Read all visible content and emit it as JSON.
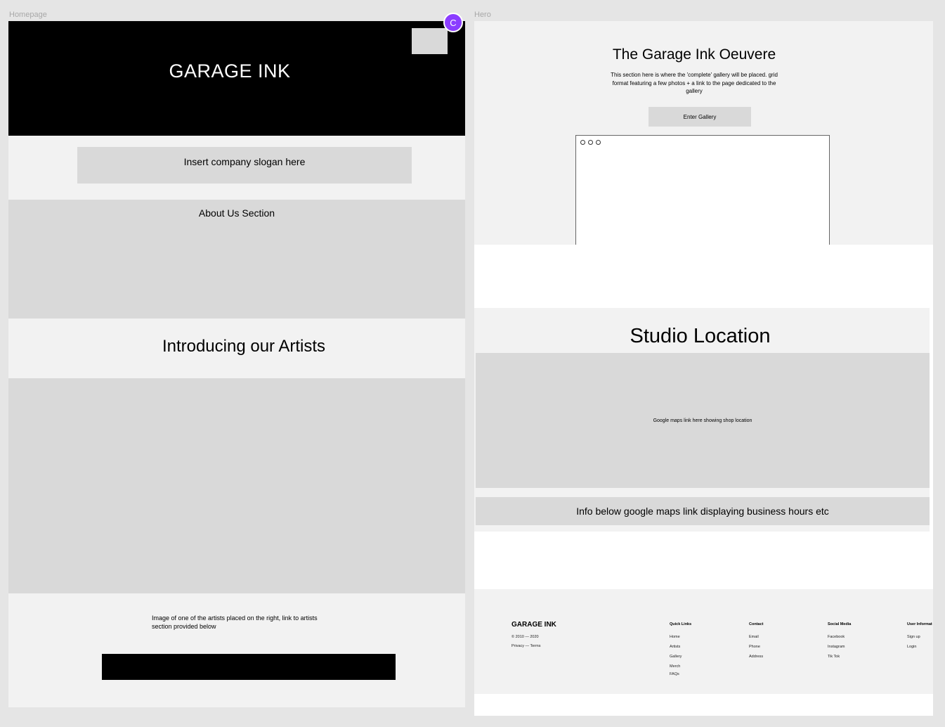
{
  "frames": {
    "homepage_label": "Homepage",
    "hero_label": "Hero"
  },
  "homepage": {
    "logo": "GARAGE INK",
    "avatar_initial": "C",
    "slogan": "Insert company slogan here",
    "about_title": "About Us Section",
    "artists_title": "Introducing our Artists",
    "artist_note": "Image of one of the artists placed on the right, link to artists section provided below"
  },
  "hero": {
    "title": "The Garage Ink Oeuvere",
    "description": "This section here is where the 'complete' gallery will be placed. grid format featuring a few photos + a link to the page dedicated to the gallery",
    "gallery_button": "Enter Gallery",
    "studio_title": "Studio Location",
    "map_text": "Google maps link here showing shop location",
    "info_text": "Info below google maps link displaying business hours etc"
  },
  "footer": {
    "brand": "GARAGE INK",
    "copyright": "© 2010 — 2020",
    "legal": "Privacy — Terms",
    "columns": [
      {
        "title": "Quick Links",
        "links": [
          "Home",
          "Artists",
          "Gallery",
          "Merch",
          "FAQs"
        ]
      },
      {
        "title": "Contact",
        "links": [
          "Email",
          "Phone",
          "Address"
        ]
      },
      {
        "title": "Social Media",
        "links": [
          "Facebook",
          "Instagram",
          "Tik Tok"
        ]
      },
      {
        "title": "User Informat",
        "links": [
          "Sign up",
          "Login"
        ]
      }
    ]
  },
  "colors": {
    "canvas": "#e5e5e5",
    "section_light": "#f2f2f2",
    "placeholder": "#d9d9d9",
    "hero_black": "#000000",
    "avatar": "#8b3dff"
  }
}
